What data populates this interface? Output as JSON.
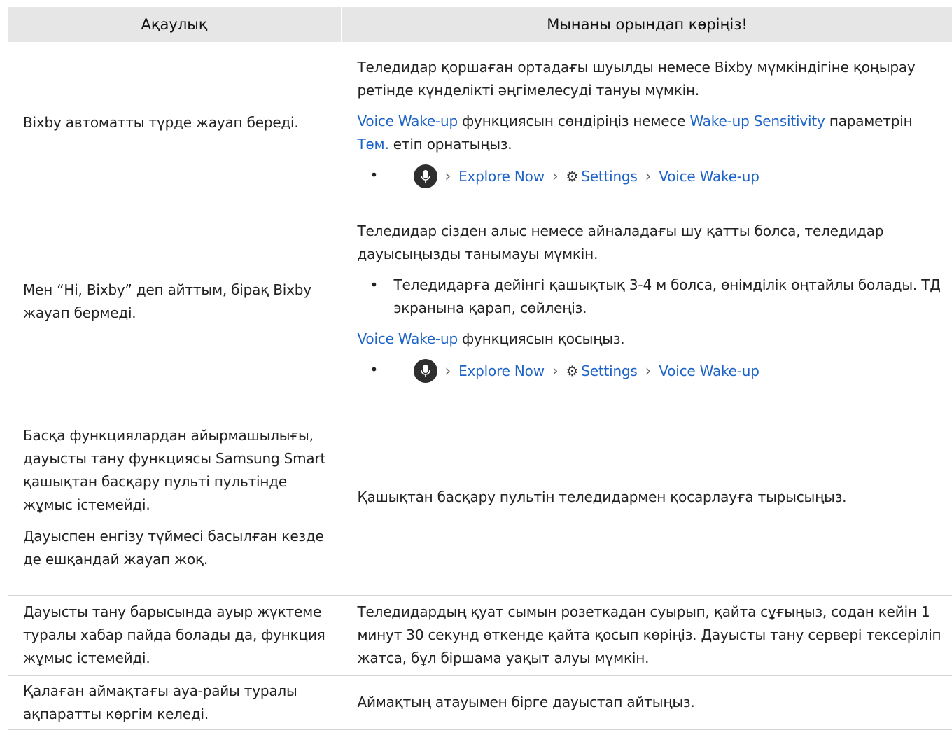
{
  "table": {
    "headers": [
      "Ақаулық",
      "Мынаны орындап көріңіз!"
    ]
  },
  "rows": {
    "r1": {
      "problem": "Bixby автоматты түрде жауап береді.",
      "sol_text1": "Теледидар қоршаған ортадағы шуылды немесе Bixby мүмкіндігіне қоңырау ретінде күнделікті әңгімелесуді тануы мүмкін.",
      "sol_link1": "Voice Wake-up",
      "sol_text2": " функциясын сөндіріңіз немесе ",
      "sol_link2": "Wake-up Sensitivity",
      "sol_text3": " параметрін ",
      "sol_link3": "Төм.",
      "sol_text4": " етіп орнатыңыз.",
      "path": [
        "Explore Now",
        "Settings",
        "Voice Wake-up"
      ]
    },
    "r2": {
      "problem": "Мен “Hi, Bixby” деп айттым, бірақ Bixby жауап бермеді.",
      "sol_text1": "Теледидар сізден алыс немесе айналадағы шу қатты болса, теледидар дауысыңызды танымауы мүмкін.",
      "bullet": "Теледидарға дейінгі қашықтық 3-4 м болса, өнімділік оңтайлы болады. ТД экранына қарап, сөйлеңіз.",
      "sol_link1": "Voice Wake-up",
      "sol_text2": " функциясын қосыңыз.",
      "path": [
        "Explore Now",
        "Settings",
        "Voice Wake-up"
      ]
    },
    "r3": {
      "problem1": "Басқа функциялардан айырмашылығы, дауысты тану функциясы Samsung Smart қашықтан басқару пульті пультінде жұмыс істемейді.",
      "problem2": "Дауыспен енгізу түймесі басылған кезде де ешқандай жауап жоқ.",
      "solution": "Қашықтан басқару пультін теледидармен қосарлауға тырысыңыз."
    },
    "r4": {
      "problem": "Дауысты тану барысында ауыр жүктеме туралы хабар пайда болады да, функция жұмыс істемейді.",
      "solution": "Теледидардың қуат сымын розеткадан суырып, қайта сұғыңыз, содан кейін 1 минут 30 секунд өткенде қайта қосып көріңіз. Дауысты тану сервері тексеріліп жатса, бұл біршама уақыт алуы мүмкін."
    },
    "r5": {
      "problem": "Қалаған аймақтағы ауа-райы туралы ақпаратты көргім келеді.",
      "solution": "Аймақтың атауымен бірге дауыстап айтыңыз."
    }
  },
  "icons": {
    "mic": "microphone-icon",
    "gear": "gear-icon",
    "chevron": "chevron-right-icon"
  },
  "colors": {
    "link": "#1e64c8",
    "header_bg": "#e6e6e6",
    "border": "#d4d4d4"
  }
}
